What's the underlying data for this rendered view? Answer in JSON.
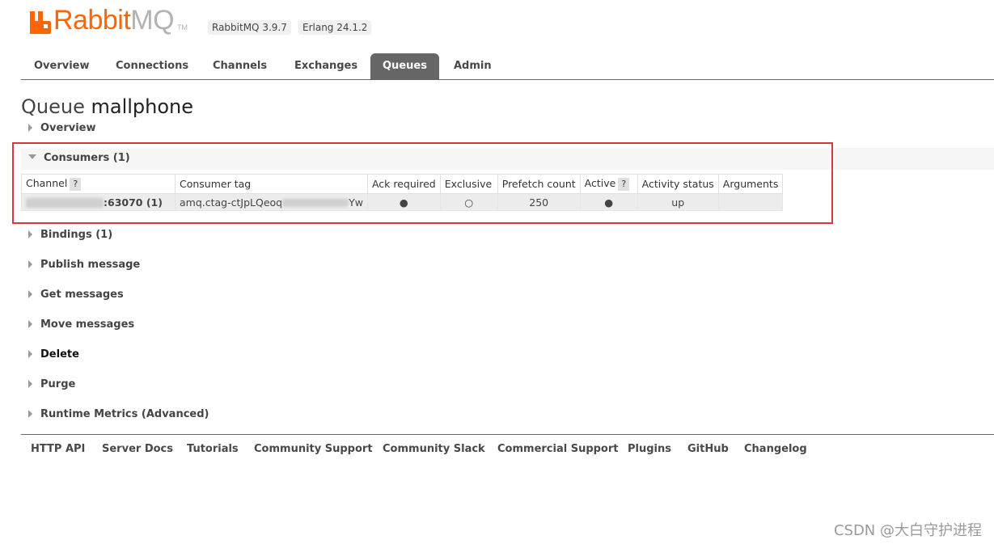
{
  "header": {
    "logo_part1": "Rabbit",
    "logo_part2": "MQ",
    "logo_tm": "TM",
    "rabbitmq_version": "RabbitMQ 3.9.7",
    "erlang_version": "Erlang 24.1.2"
  },
  "tabs": [
    {
      "label": "Overview",
      "active": false
    },
    {
      "label": "Connections",
      "active": false
    },
    {
      "label": "Channels",
      "active": false
    },
    {
      "label": "Exchanges",
      "active": false
    },
    {
      "label": "Queues",
      "active": true
    },
    {
      "label": "Admin",
      "active": false
    }
  ],
  "page": {
    "title_prefix": "Queue",
    "queue_name": "mallphone"
  },
  "sections": {
    "overview": "Overview",
    "consumers": "Consumers (1)",
    "bindings": "Bindings (1)",
    "publish": "Publish message",
    "get": "Get messages",
    "move": "Move messages",
    "delete": "Delete",
    "purge": "Purge",
    "runtime": "Runtime Metrics (Advanced)"
  },
  "consumers_table": {
    "headers": {
      "channel": "Channel",
      "consumer_tag": "Consumer tag",
      "ack_required": "Ack required",
      "exclusive": "Exclusive",
      "prefetch_count": "Prefetch count",
      "active": "Active",
      "activity_status": "Activity status",
      "arguments": "Arguments",
      "help": "?"
    },
    "rows": [
      {
        "channel": ":63070 (1)",
        "consumer_tag": "amq.ctag-ctJpLQeoq",
        "consumer_tag_tail": "Yw",
        "ack_required": "●",
        "exclusive": "○",
        "prefetch_count": "250",
        "active": "●",
        "activity_status": "up",
        "arguments": ""
      }
    ]
  },
  "footer": {
    "links": [
      "HTTP API",
      "Server Docs",
      "Tutorials",
      "Community Support",
      "Community Slack",
      "Commercial Support",
      "Plugins",
      "GitHub",
      "Changelog"
    ]
  },
  "watermark": "CSDN @大白守护进程",
  "colors": {
    "brand_orange": "#ff6600",
    "logo_gray": "#b3b3b3",
    "active_tab_bg": "#666666",
    "highlight_border": "#d9363e"
  }
}
